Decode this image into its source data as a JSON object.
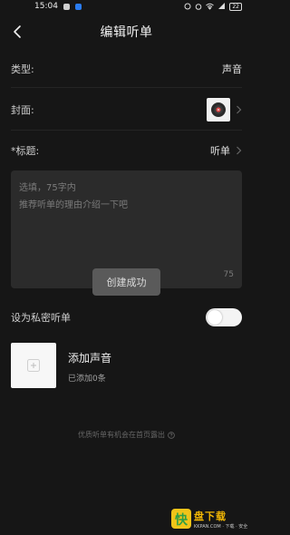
{
  "status_bar": {
    "time": "15:04",
    "battery": "22"
  },
  "nav": {
    "title": "编辑听单",
    "back_icon": "back-arrow-icon"
  },
  "fields": {
    "type": {
      "label": "类型:",
      "value": "声音"
    },
    "cover": {
      "label": "封面:"
    },
    "title": {
      "label": "*标题:",
      "value": "听单"
    }
  },
  "description": {
    "placeholder_line1": "选填，75字内",
    "placeholder_line2": "推荐听单的理由介绍一下吧",
    "max_count": "75"
  },
  "toast": {
    "text": "创建成功"
  },
  "private": {
    "label": "设为私密听单",
    "enabled": false
  },
  "add_sound": {
    "title": "添加声音",
    "subtitle": "已添加0条"
  },
  "footer": {
    "tip": "优质听单有机会在首页露出"
  },
  "watermark": {
    "logo_char": "快",
    "main": "盘下载",
    "sub": "KKPAN.COM  ·  下载  ·  安全"
  },
  "colors": {
    "background": "#161616",
    "input_background": "#2b2b2b",
    "toast_background": "#5a5a5a",
    "toggle_track": "#f4f4f4"
  }
}
